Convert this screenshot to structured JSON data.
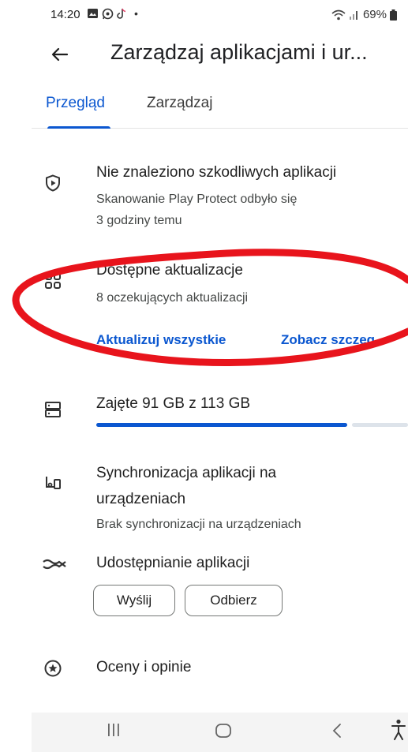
{
  "status_bar": {
    "time": "14:20",
    "battery": "69%",
    "dot": "•"
  },
  "app_bar": {
    "title": "Zarządzaj aplikacjami i ur..."
  },
  "tabs": [
    {
      "label": "Przegląd",
      "active": true
    },
    {
      "label": "Zarządzaj",
      "active": false
    }
  ],
  "play_protect": {
    "title": "Nie znaleziono szkodliwych aplikacji",
    "line1": "Skanowanie Play Protect odbyło się",
    "line2": "3 godziny temu",
    "icon": "shield-play-icon"
  },
  "updates": {
    "title": "Dostępne aktualizacje",
    "subtitle": "8 oczekujących aktualizacji",
    "update_all_label": "Aktualizuj wszystkie",
    "see_details_label": "Zobacz szczeg...",
    "icon": "apps-grid-icon"
  },
  "storage": {
    "title": "Zajęte 91 GB z 113 GB",
    "used_gb": 91,
    "total_gb": 113,
    "icon": "storage-icon"
  },
  "sync": {
    "title_line1": "Synchronizacja aplikacji na",
    "title_line2": "urządzeniach",
    "subtitle": "Brak synchronizacji na urządzeniach",
    "icon": "devices-sync-icon"
  },
  "share": {
    "title": "Udostępnianie aplikacji",
    "send_label": "Wyślij",
    "receive_label": "Odbierz",
    "icon": "share-swap-icon"
  },
  "ratings": {
    "title": "Oceny i opinie",
    "icon": "star-circle-icon"
  },
  "colors": {
    "accent": "#0b57d0",
    "annotation": "#e8141c"
  }
}
